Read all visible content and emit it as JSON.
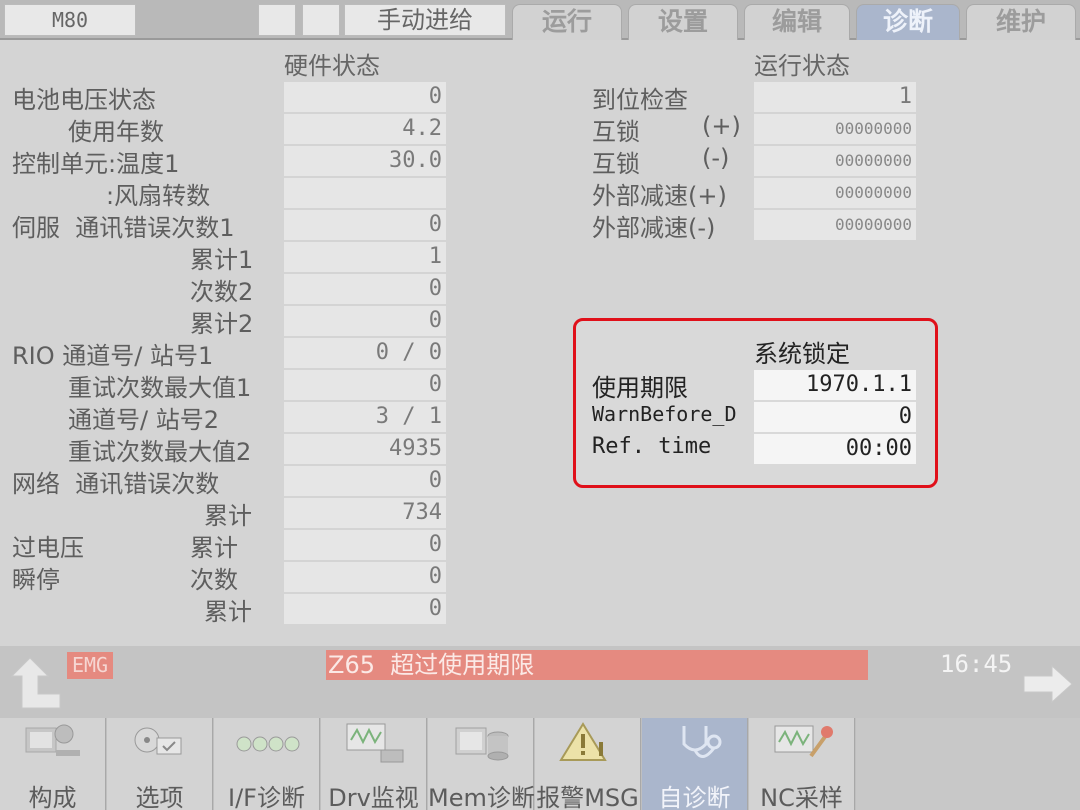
{
  "topbar": {
    "model": "M80",
    "mode": "手动进给",
    "tabs": [
      "运行",
      "设置",
      "编辑",
      "诊断",
      "维护"
    ],
    "active_tab": "诊断"
  },
  "hardware": {
    "title": "硬件状态",
    "rows": [
      {
        "label": "电池电压状态",
        "value": "0"
      },
      {
        "label": "使用年数",
        "value": "4.2"
      },
      {
        "label": "控制单元:温度1",
        "value": "30.0"
      },
      {
        "label": ":风扇转数",
        "value": ""
      },
      {
        "label": "伺服  通讯错误次数1",
        "value": "0"
      },
      {
        "label": "累计1",
        "value": "1"
      },
      {
        "label": "次数2",
        "value": "0"
      },
      {
        "label": "累计2",
        "value": "0"
      },
      {
        "label": "RIO 通道号/ 站号1",
        "value": "0 / 0"
      },
      {
        "label": "重试次数最大值1",
        "value": "0"
      },
      {
        "label": "通道号/ 站号2",
        "value": "3 / 1"
      },
      {
        "label": "重试次数最大值2",
        "value": "4935"
      },
      {
        "label": "网络  通讯错误次数",
        "value": "0"
      },
      {
        "label": "累计",
        "value": "734"
      },
      {
        "label": "过电压",
        "sublabel": "累计",
        "value": "0"
      },
      {
        "label": "瞬停",
        "sublabel": "次数",
        "value": "0"
      },
      {
        "label": "累计",
        "value": "0"
      }
    ]
  },
  "operation": {
    "title": "运行状态",
    "rows": [
      {
        "label": "到位检查",
        "value": "1"
      },
      {
        "label": "互锁",
        "sign": "(+)",
        "value": "00000000"
      },
      {
        "label": "互锁",
        "sign": "(-)",
        "value": "00000000"
      },
      {
        "label": "外部减速(+)",
        "value": "00000000"
      },
      {
        "label": "外部减速(-)",
        "value": "00000000"
      }
    ]
  },
  "system_lock": {
    "title": "系统锁定",
    "rows": [
      {
        "label": "使用期限",
        "value": "1970.1.1"
      },
      {
        "label": "WarnBefore_D",
        "value": "0"
      },
      {
        "label": "Ref. time",
        "value": "00:00"
      }
    ]
  },
  "status": {
    "emg": "EMG",
    "alarm": "Z65  超过使用期限",
    "clock": "16:45"
  },
  "softkeys": [
    {
      "label": "构成",
      "icon": "configuration-icon"
    },
    {
      "label": "选项",
      "icon": "option-icon"
    },
    {
      "label": "I/F诊断",
      "icon": "interface-diagnosis-icon"
    },
    {
      "label": "Drv监视",
      "icon": "drive-monitor-icon"
    },
    {
      "label": "Mem诊断",
      "icon": "memory-diagnosis-icon"
    },
    {
      "label": "报警MSG",
      "icon": "alarm-warning-icon"
    },
    {
      "label": "自诊断",
      "icon": "stethoscope-icon",
      "active": true
    },
    {
      "label": "NC采样",
      "icon": "nc-sampling-icon"
    }
  ],
  "colors": {
    "active_tab": "#aab6cc",
    "alarm_bg": "#e58a80",
    "highlight_border": "#e0101a"
  }
}
